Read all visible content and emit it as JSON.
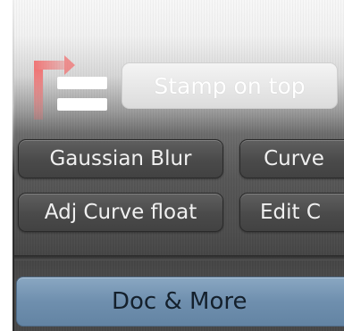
{
  "buttons": {
    "stamp_on_top": "Stamp on top",
    "gaussian_blur": "Gaussian Blur",
    "curve": "Curve",
    "adj_curve_float": "Adj Curve float",
    "edit_c": "Edit C",
    "doc_and_more": "Doc & More"
  },
  "icons": {
    "stamp": "stamp-on-top-icon"
  },
  "colors": {
    "accent_blue": "#6f8fae",
    "icon_red": "#f26b6b",
    "button_dark": "#4a4a4a",
    "button_disabled": "#dcdcdc"
  }
}
